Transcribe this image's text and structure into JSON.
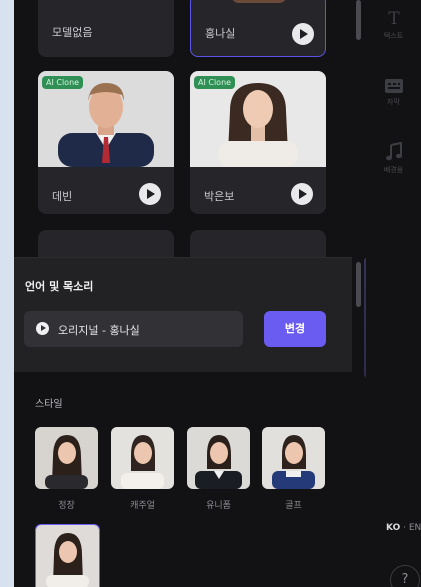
{
  "models": [
    {
      "name": "모델없음",
      "badge": "",
      "selected": false
    },
    {
      "name": "홍나실",
      "badge": "",
      "selected": true
    },
    {
      "name": "데빈",
      "badge": "AI Clone",
      "selected": false
    },
    {
      "name": "박은보",
      "badge": "AI Clone",
      "selected": false
    }
  ],
  "voice": {
    "title": "언어 및 목소리",
    "value": "오리지널 - 홍나실",
    "change_label": "변경"
  },
  "style": {
    "title": "스타일",
    "items": [
      "정장",
      "캐주얼",
      "유니폼",
      "골프"
    ]
  },
  "rail": {
    "items": [
      {
        "label": "텍스트",
        "icon": "text-icon"
      },
      {
        "label": "자막",
        "icon": "subtitle-icon"
      },
      {
        "label": "배경음",
        "icon": "music-icon"
      }
    ],
    "lang_ko": "KO",
    "lang_sep": " · ",
    "lang_en": "EN",
    "help": "?"
  },
  "colors": {
    "accent": "#6a5cf0",
    "panel_bg": "#121214",
    "card_bg": "#26262a",
    "badge_green": "#2f8f54"
  }
}
